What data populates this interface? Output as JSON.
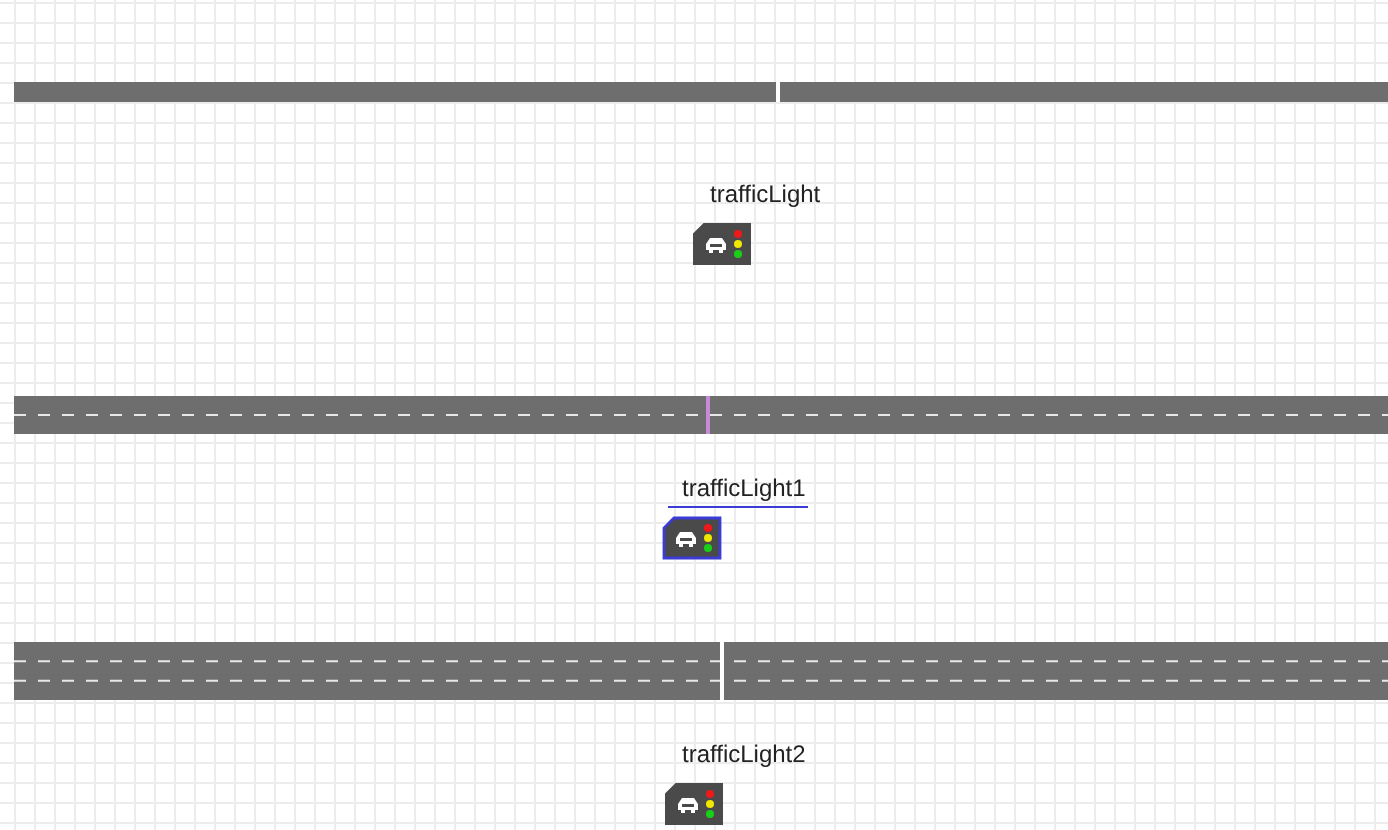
{
  "roads": [
    {
      "kind": "single",
      "stop_line_highlighted": false
    },
    {
      "kind": "double",
      "stop_line_highlighted": true
    },
    {
      "kind": "triple",
      "stop_line_highlighted": false
    }
  ],
  "traffic_lights": [
    {
      "label": "trafficLight",
      "selected": false
    },
    {
      "label": "trafficLight1",
      "selected": true
    },
    {
      "label": "trafficLight2",
      "selected": false
    }
  ]
}
